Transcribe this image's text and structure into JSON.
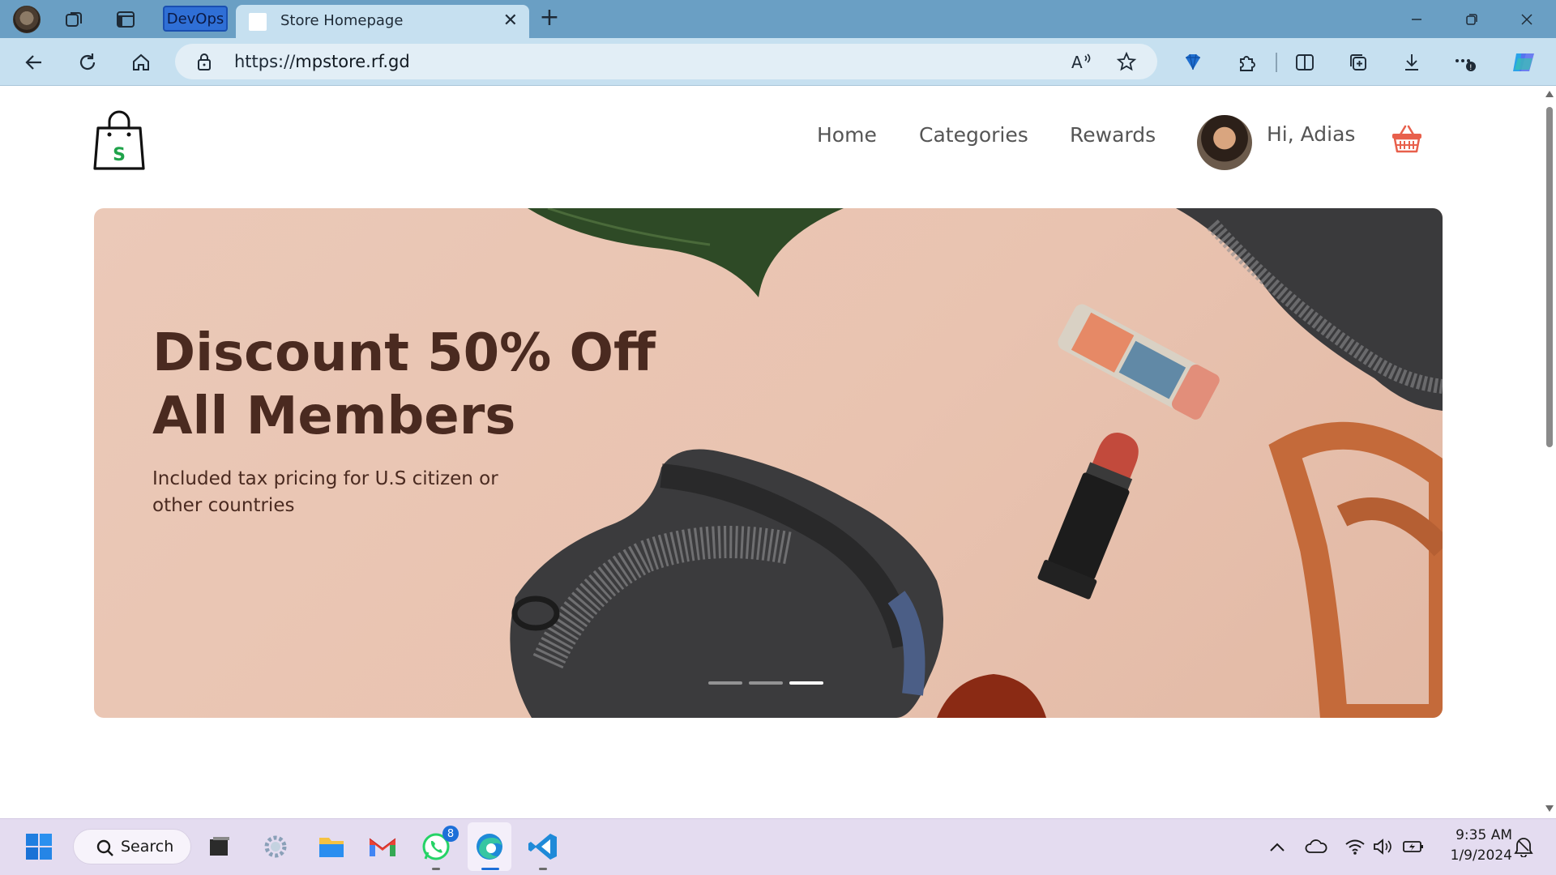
{
  "browser": {
    "workspace_label": "DevOps",
    "tab_title": "Store Homepage",
    "tab_close": "✕",
    "new_tab": "+",
    "url_scheme": "https://",
    "url_host": "mpstore.rf.gd"
  },
  "site": {
    "logo_letter": "S",
    "nav": {
      "home": "Home",
      "categories": "Categories",
      "rewards": "Rewards"
    },
    "greeting": "Hi, Adias",
    "hero": {
      "title": "Discount 50% Off All Members",
      "subtitle": "Included tax pricing for U.S citizen or other countries",
      "slide_count": 3,
      "active_slide": 3
    }
  },
  "taskbar": {
    "search_label": "Search",
    "whatsapp_badge": "8",
    "time": "9:35 AM",
    "date": "1/9/2024"
  },
  "colors": {
    "titlebar": "#6a9fc4",
    "addressbar": "#c6e0f0",
    "hero_bg": "#ebc9b8",
    "hero_text": "#4a2a20",
    "logo_green": "#1fa34a",
    "basket_red": "#e8604c",
    "taskbar": "#e4dcf0"
  }
}
